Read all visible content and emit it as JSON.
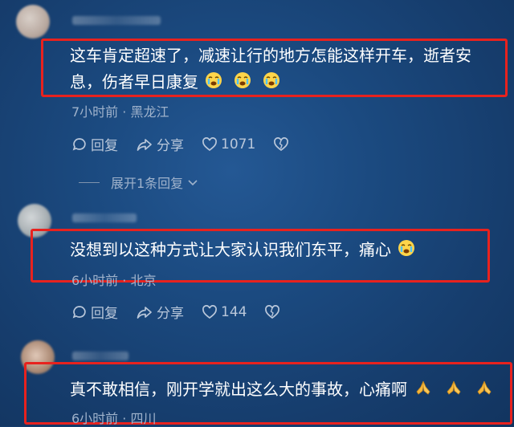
{
  "comments": [
    {
      "text_line1": "这车肯定超速了，减速让行的地方怎能这样开车，逝者安",
      "text_line2": "息，伤者早日康复",
      "emoji_name": "crying-face-icon",
      "emoji_count": 3,
      "time": "7小时前",
      "location": "黑龙江",
      "reply_label": "回复",
      "share_label": "分享",
      "likes": "1071",
      "expand_label": "展开1条回复"
    },
    {
      "text_line1": "没想到以这种方式让大家认识我们东平，痛心",
      "emoji_name": "crying-face-icon",
      "emoji_count": 1,
      "time": "6小时前",
      "location": "北京",
      "reply_label": "回复",
      "share_label": "分享",
      "likes": "144"
    },
    {
      "text_line1": "真不敢相信，刚开学就出这么大的事故，心痛啊",
      "emoji_name": "praying-hands-icon",
      "emoji_count": 3,
      "time": "6小时前",
      "location": "四川"
    }
  ],
  "separator": " · ",
  "colors": {
    "highlight_border": "#e8221e",
    "background": "#1b4a80",
    "meta_text": "#9fb2cb"
  }
}
